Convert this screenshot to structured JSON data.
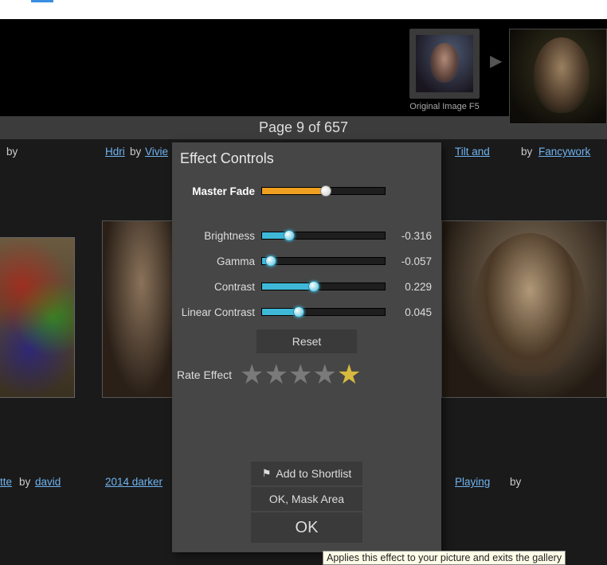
{
  "page_indicator": "Page 9 of 657",
  "panel": {
    "title": "Effect Controls",
    "master_fade": {
      "label": "Master Fade",
      "pct": 52
    },
    "sliders": [
      {
        "label": "Brightness",
        "value": "-0.316",
        "pct": 22
      },
      {
        "label": "Gamma",
        "value": "-0.057",
        "pct": 7
      },
      {
        "label": "Contrast",
        "value": "0.229",
        "pct": 42
      },
      {
        "label": "Linear Contrast",
        "value": "0.045",
        "pct": 30
      }
    ],
    "reset": "Reset",
    "rate_label": "Rate Effect",
    "stars": 5,
    "selected_star": 5,
    "btn_shortlist": "Add to Shortlist",
    "btn_mask": "OK, Mask Area",
    "btn_ok": "OK"
  },
  "thumbs": {
    "original_label": "Original Image F5"
  },
  "toprow": {
    "by1": "by",
    "hdri": "Hdri",
    "by2": "by",
    "vivie": "Vivie",
    "tilt": "Tilt and",
    "by3": "by",
    "fancy": "Fancywork"
  },
  "bottomrow": {
    "tte": "tte",
    "by1": "by",
    "david": "david",
    "darker": "2014 darker",
    "playing": "Playing",
    "by2": "by"
  },
  "tooltip": "Applies this effect to your picture and exits the gallery"
}
